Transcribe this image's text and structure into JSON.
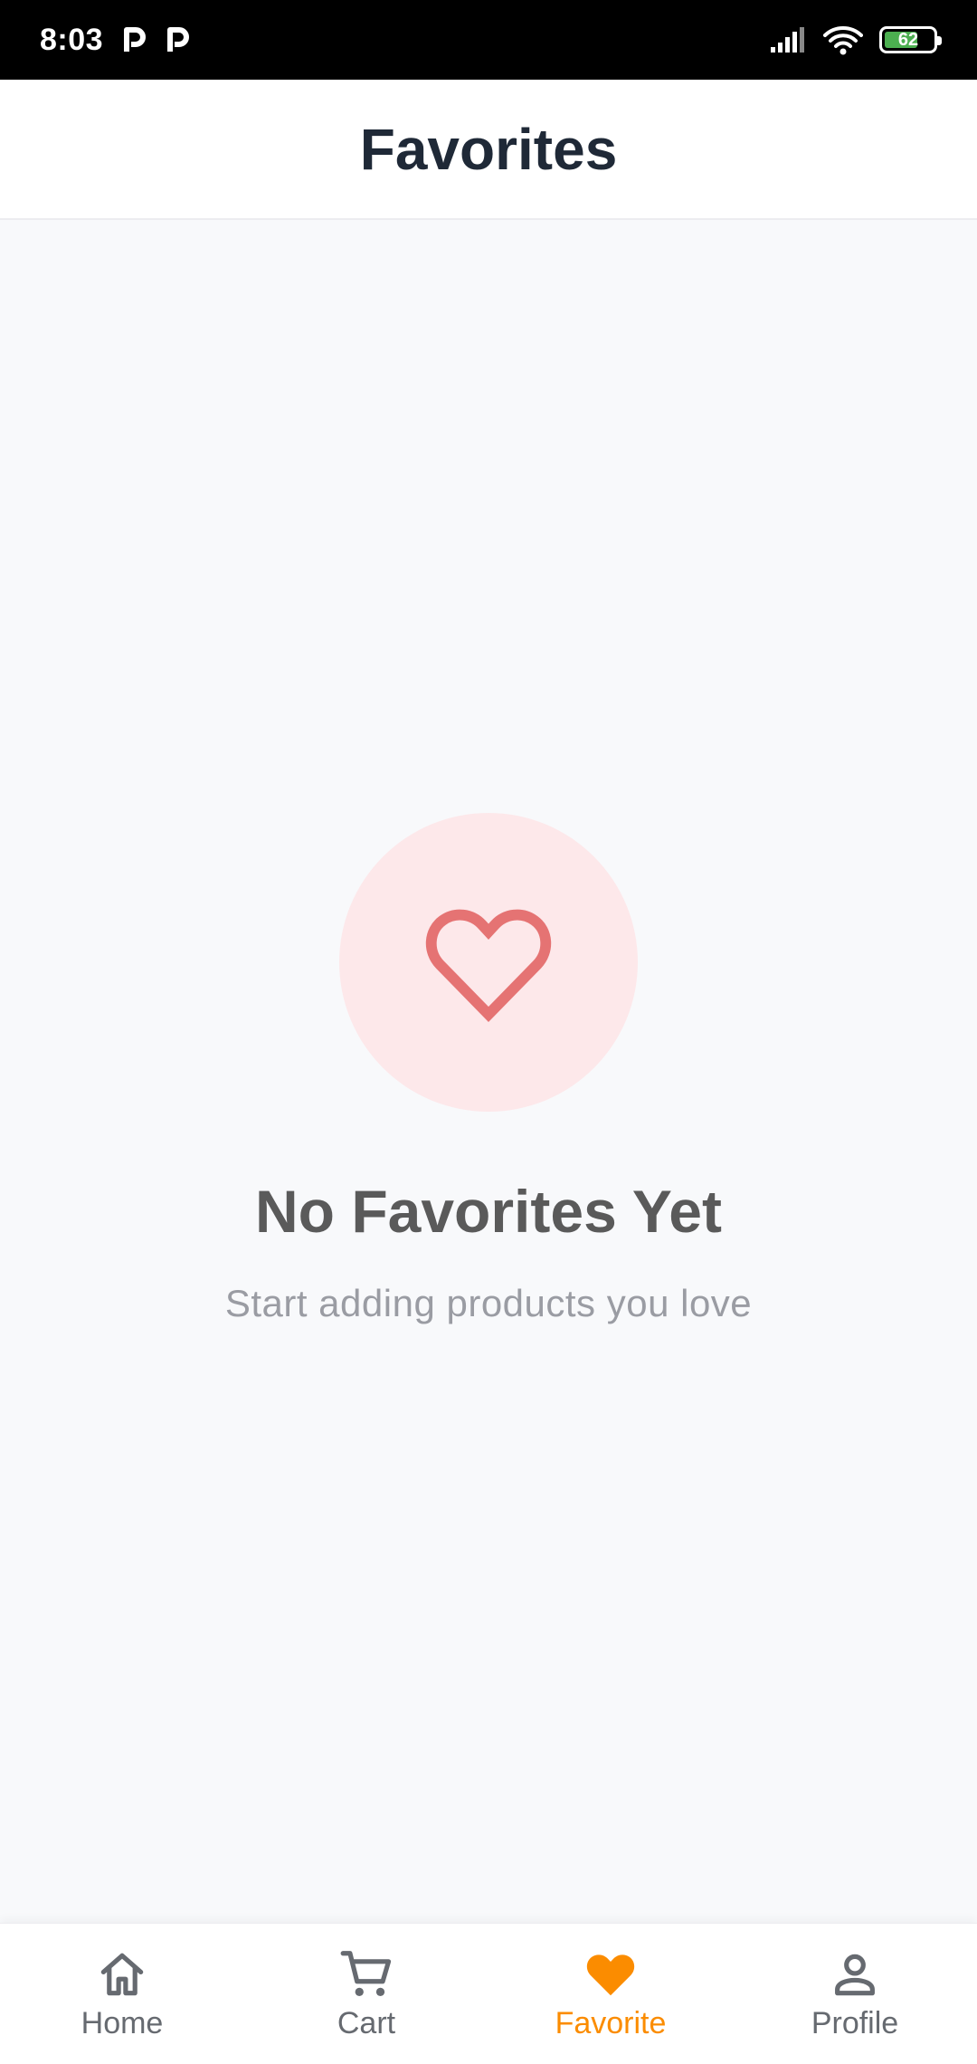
{
  "status_bar": {
    "time": "8:03",
    "battery_level": "62",
    "battery_fraction": 0.62,
    "icons": [
      "parking-icon",
      "parking-icon",
      "signal-icon",
      "wifi-icon",
      "battery-icon"
    ]
  },
  "header": {
    "title": "Favorites"
  },
  "empty_state": {
    "icon": "heart-outline-icon",
    "title": "No Favorites Yet",
    "subtitle": "Start adding products you love"
  },
  "bottom_nav": {
    "items": [
      {
        "label": "Home",
        "icon": "home-icon",
        "active": false
      },
      {
        "label": "Cart",
        "icon": "cart-icon",
        "active": false
      },
      {
        "label": "Favorite",
        "icon": "heart-icon",
        "active": true
      },
      {
        "label": "Profile",
        "icon": "person-icon",
        "active": false
      }
    ]
  },
  "colors": {
    "accent": "#fb8c00",
    "heart": "#e57373",
    "heart_bg": "#fde8ea",
    "title": "#1f2937",
    "background": "#f8f9fb"
  }
}
